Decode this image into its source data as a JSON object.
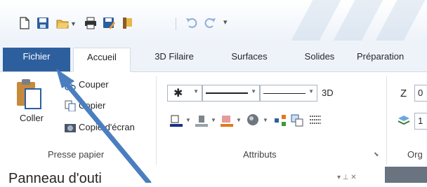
{
  "quick_access": {
    "icons": [
      "new-file-icon",
      "save-icon",
      "open-folder-icon",
      "dropdown-arrow-icon",
      "print-icon",
      "save-as-icon",
      "bookmark-icon",
      "undo-icon",
      "redo-icon",
      "customize-icon"
    ]
  },
  "tabs": {
    "file": "Fichier",
    "items": [
      "Accueil",
      "3D Filaire",
      "Surfaces",
      "Solides",
      "Préparation"
    ]
  },
  "groups": {
    "clipboard": {
      "label": "Presse papier",
      "paste": "Coller",
      "cut": "Couper",
      "copy": "Copier",
      "screenshot": "Copie d'écran"
    },
    "attributes": {
      "label": "Attributs",
      "label_3d": "3D"
    },
    "org": {
      "label": "Org",
      "z_label": "Z",
      "z_value": "0",
      "layer_value": "1"
    }
  },
  "pane": {
    "title": "Panneau d'outi"
  },
  "colors": {
    "file_tab": "#2d5f9e",
    "arrow": "#4a7ec0",
    "accent": "#2d5f9e"
  }
}
